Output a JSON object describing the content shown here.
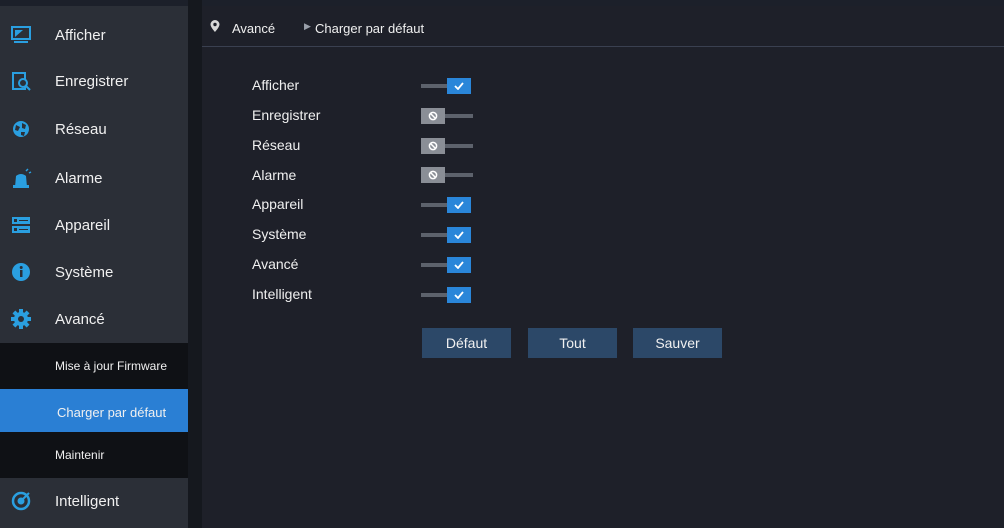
{
  "sidebar": {
    "items": [
      {
        "label": "Afficher",
        "icon": "monitor-icon"
      },
      {
        "label": "Enregistrer",
        "icon": "record-search-icon"
      },
      {
        "label": "Réseau",
        "icon": "network-globe-icon"
      },
      {
        "label": "Alarme",
        "icon": "alarm-icon"
      },
      {
        "label": "Appareil",
        "icon": "device-storage-icon"
      },
      {
        "label": "Système",
        "icon": "info-icon"
      },
      {
        "label": "Avancé",
        "icon": "gear-icon"
      },
      {
        "label": "Intelligent",
        "icon": "intelligent-icon"
      }
    ],
    "subitems": [
      {
        "label": "Mise à jour Firmware"
      },
      {
        "label": "Charger par défaut",
        "active": true
      },
      {
        "label": "Maintenir"
      }
    ]
  },
  "breadcrumb": {
    "parent": "Avancé",
    "current": "Charger par défaut"
  },
  "settings": [
    {
      "label": "Afficher",
      "enabled": true
    },
    {
      "label": "Enregistrer",
      "enabled": false
    },
    {
      "label": "Réseau",
      "enabled": false
    },
    {
      "label": "Alarme",
      "enabled": false
    },
    {
      "label": "Appareil",
      "enabled": true
    },
    {
      "label": "Système",
      "enabled": true
    },
    {
      "label": "Avancé",
      "enabled": true
    },
    {
      "label": "Intelligent",
      "enabled": true
    }
  ],
  "buttons": {
    "default_label": "Défaut",
    "all_label": "Tout",
    "save_label": "Sauver"
  },
  "colors": {
    "accent": "#2a86d9",
    "button": "#2c4868",
    "sidebar": "#2b2f37"
  }
}
